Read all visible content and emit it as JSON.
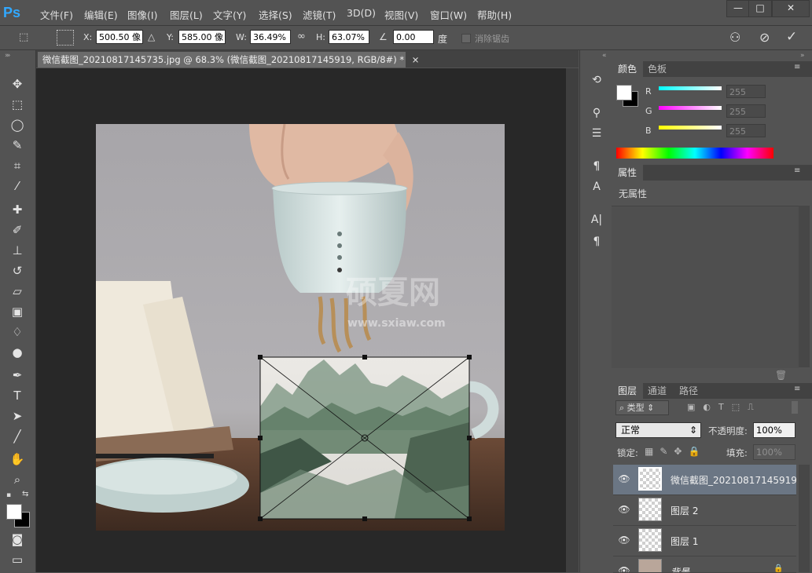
{
  "app": {
    "logo": "Ps"
  },
  "menu": [
    "文件(F)",
    "编辑(E)",
    "图像(I)",
    "图层(L)",
    "文字(Y)",
    "选择(S)",
    "滤镜(T)",
    "3D(D)",
    "视图(V)",
    "窗口(W)",
    "帮助(H)"
  ],
  "window_controls": {
    "minimize": "—",
    "restore": "□",
    "close": "✕"
  },
  "options": {
    "x_label": "X:",
    "x_value": "500.50 像",
    "y_label": "Y:",
    "y_value": "585.00 像",
    "w_label": "W:",
    "w_value": "36.49%",
    "h_label": "H:",
    "h_value": "63.07%",
    "angle_value": "0.00",
    "angle_unit": "度",
    "antialias_label": "消除锯齿"
  },
  "document": {
    "tab_title": "微信截图_20210817145735.jpg @ 68.3% (微信截图_20210817145919, RGB/8#) *",
    "tab_close": "×",
    "watermark": "硕夏网",
    "watermark_url": "www.sxiaw.com"
  },
  "color_panel": {
    "tabs": [
      "颜色",
      "色板"
    ],
    "channels": [
      {
        "label": "R",
        "value": "255",
        "color": "#ff3030"
      },
      {
        "label": "G",
        "value": "255",
        "color": "#30ff30"
      },
      {
        "label": "B",
        "value": "255",
        "color": "#3030ff"
      }
    ]
  },
  "properties_panel": {
    "tab": "属性",
    "content": "无属性"
  },
  "layers_panel": {
    "tabs": [
      "图层",
      "通道",
      "路径"
    ],
    "filter_kind": "类型",
    "blend_mode": "正常",
    "opacity_label": "不透明度:",
    "opacity_value": "100%",
    "lock_label": "锁定:",
    "fill_label": "填充:",
    "fill_value": "100%",
    "layers": [
      {
        "name": "微信截图_20210817145919",
        "selected": true
      },
      {
        "name": "图层 2",
        "selected": false
      },
      {
        "name": "图层 1",
        "selected": false
      },
      {
        "name": "背景",
        "selected": false
      }
    ]
  }
}
